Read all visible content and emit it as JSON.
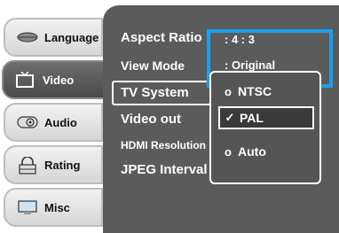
{
  "sidebar": {
    "tabs": [
      {
        "label": "Language",
        "icon": "lips-icon"
      },
      {
        "label": "Video",
        "icon": "tv-icon"
      },
      {
        "label": "Audio",
        "icon": "speaker-icon"
      },
      {
        "label": "Rating",
        "icon": "lock-icon"
      },
      {
        "label": "Misc",
        "icon": "monitor-icon"
      }
    ]
  },
  "menu": {
    "options": [
      {
        "label": "Aspect Ratio",
        "value": ": 4 : 3"
      },
      {
        "label": "View Mode",
        "value": ": Original"
      },
      {
        "label": "TV System",
        "value": ""
      },
      {
        "label": "Video out",
        "value": ""
      },
      {
        "label": "HDMI Resolution",
        "value": ""
      },
      {
        "label": "JPEG Interval",
        "value": ""
      }
    ]
  },
  "dropdown": {
    "items": [
      {
        "label": "NTSC",
        "mark": "o"
      },
      {
        "label": "PAL",
        "mark": "✓"
      },
      {
        "label": "Auto",
        "mark": "o"
      }
    ],
    "selected": "PAL"
  },
  "colors": {
    "panel": "#5b5b5b",
    "highlight": "#1aa0ee"
  }
}
